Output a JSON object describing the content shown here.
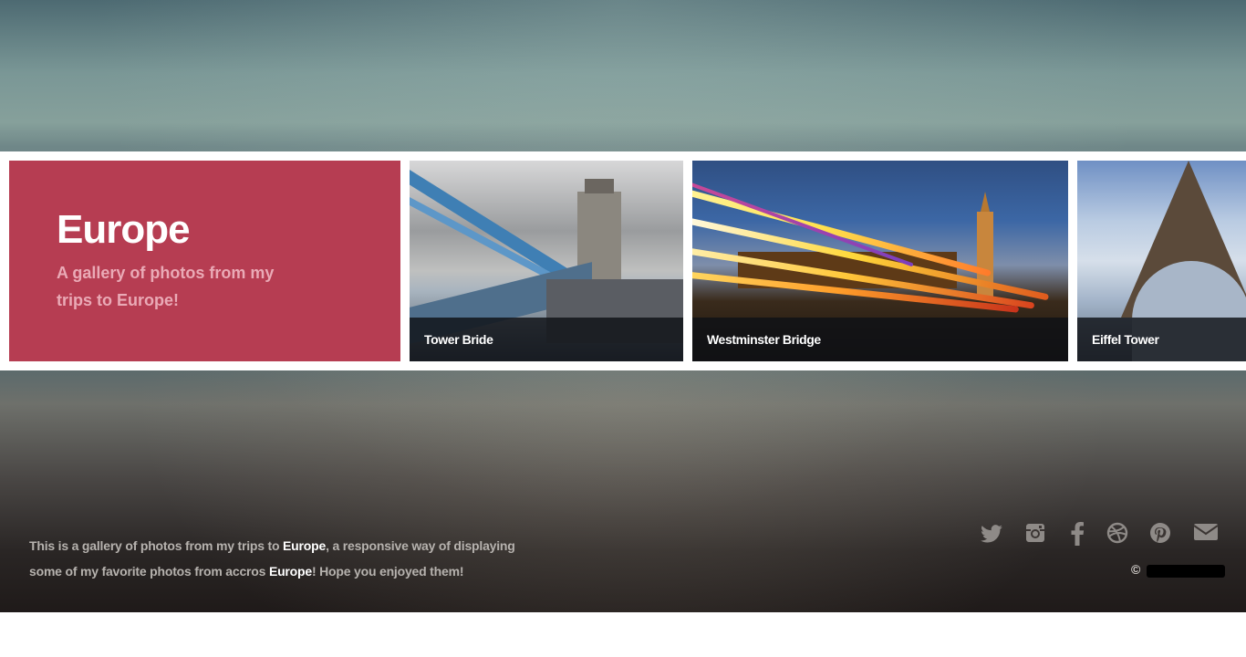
{
  "hero": {
    "title": "Europe",
    "subtitle": "A gallery of photos from my trips to Europe!",
    "color": "#b63d52"
  },
  "gallery": [
    {
      "caption": "Tower Bride"
    },
    {
      "caption": "Westminster Bridge"
    },
    {
      "caption": "Eiffel Tower"
    }
  ],
  "footer": {
    "text_part1": "This is a gallery of photos from my trips to ",
    "bold1": "Europe",
    "text_part2": ", a responsive way of displaying some of my favorite photos from accros ",
    "bold2": "Europe",
    "text_part3": "! Hope you enjoyed them!",
    "copyright_symbol": "©"
  },
  "socials": [
    "twitter-icon",
    "instagram-icon",
    "facebook-icon",
    "dribbble-icon",
    "pinterest-icon",
    "email-icon"
  ]
}
